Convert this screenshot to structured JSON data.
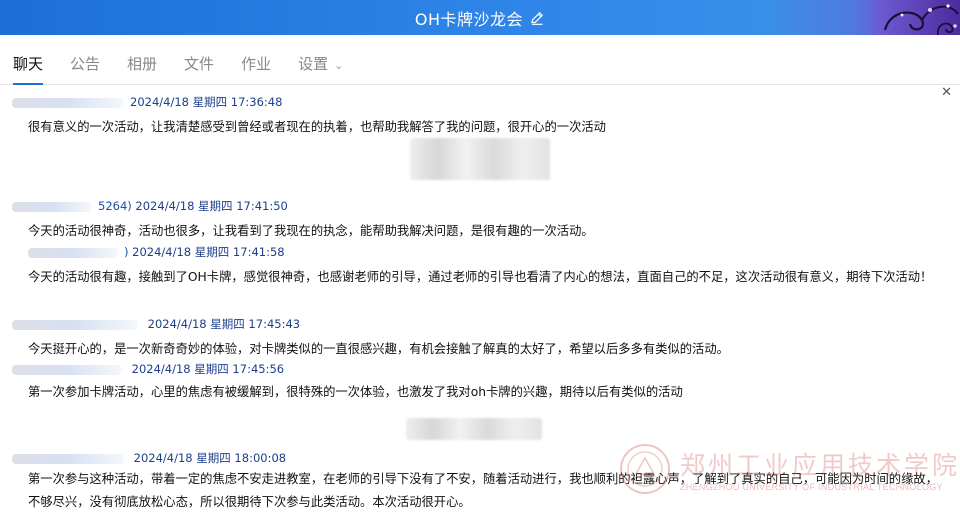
{
  "window": {
    "title": "OH卡牌沙龙会",
    "edit_icon": "pencil-icon",
    "close_icon": "close-icon"
  },
  "tabs": [
    {
      "label": "聊天",
      "active": true
    },
    {
      "label": "公告"
    },
    {
      "label": "相册"
    },
    {
      "label": "文件"
    },
    {
      "label": "作业"
    },
    {
      "label": "设置",
      "has_dropdown": true
    }
  ],
  "messages": [
    {
      "sender": "",
      "time": "2024/4/18 星期四 17:36:48",
      "text": "很有意义的一次活动，让我清楚感受到曾经或者现在的执着，也帮助我解答了我的问题，很开心的一次活动"
    },
    {
      "sender": "5264)",
      "time": "2024/4/18 星期四 17:41:50",
      "text": "今天的活动很神奇，活动也很多，让我看到了我现在的执念，能帮助我解决问题，是很有趣的一次活动。"
    },
    {
      "sender": ")",
      "time": "2024/4/18 星期四 17:41:58",
      "text": "今天的活动很有趣，接触到了OH卡牌，感觉很神奇，也感谢老师的引导，通过老师的引导也看清了内心的想法，直面自己的不足，这次活动很有意义，期待下次活动！"
    },
    {
      "sender": "",
      "time": "2024/4/18 星期四 17:45:43",
      "text": "今天挺开心的，是一次新奇奇妙的体验，对卡牌类似的一直很感兴趣，有机会接触了解真的太好了，希望以后多多有类似的活动。"
    },
    {
      "sender": "",
      "time": "2024/4/18 星期四 17:45:56",
      "text": "第一次参加卡牌活动，心里的焦虑有被缓解到，很特殊的一次体验，也激发了我对oh卡牌的兴趣，期待以后有类似的活动"
    },
    {
      "sender": "",
      "time": "2024/4/18 星期四 18:00:08",
      "text": "第一次参与这种活动，带着一定的焦虑不安走进教室，在老师的引导下没有了不安，随着活动进行，我也顺利的袒露心声，了解到了真实的自己，可能因为时间的缘故，不够尽兴，没有彻底放松心态，所以很期待下次参与此类活动。本次活动很开心。"
    }
  ],
  "watermark": {
    "name_cn": "郑州工业应用技术学院",
    "name_en": "ZHENGZHOU UNIVERSITY OF INDUSTRIAL TECHNOLOGY"
  }
}
